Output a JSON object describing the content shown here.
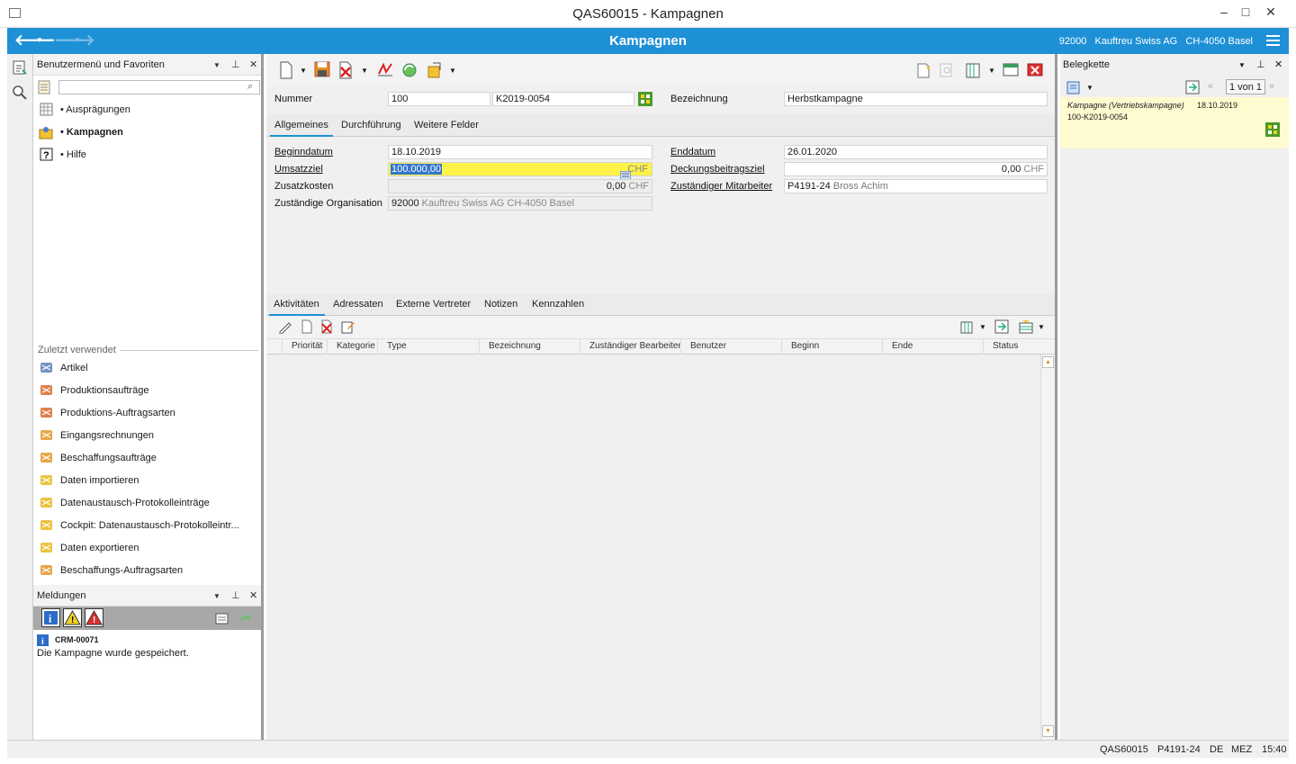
{
  "window": {
    "title": "QAS60015 - Kampagnen",
    "minimize": "–",
    "maximize": "□",
    "close": "✕"
  },
  "navbar": {
    "title": "Kampagnen",
    "org_code": "92000",
    "org_name": "Kauftreu Swiss AG",
    "org_location": "CH-4050 Basel"
  },
  "favorites": {
    "title": "Benutzermenü und Favoriten",
    "search_placeholder": "",
    "items": [
      {
        "label": "• Ausprägungen",
        "icon": "grid-icon"
      },
      {
        "label": "• Kampagnen",
        "icon": "campaign-icon"
      },
      {
        "label": "• Hilfe",
        "icon": "help-icon"
      }
    ],
    "recent_title": "Zuletzt verwendet",
    "recent": [
      {
        "label": "Artikel",
        "icon": "article-icon",
        "color": "#5a7fb8"
      },
      {
        "label": "Produktionsaufträge",
        "icon": "production-icon",
        "color": "#d86a2b"
      },
      {
        "label": "Produktions-Auftragsarten",
        "icon": "production-icon",
        "color": "#d86a2b"
      },
      {
        "label": "Eingangsrechnungen",
        "icon": "purchase-icon",
        "color": "#e2962a"
      },
      {
        "label": "Beschaffungsaufträge",
        "icon": "purchase-icon",
        "color": "#e2962a"
      },
      {
        "label": "Daten importieren",
        "icon": "data-icon",
        "color": "#e8b820"
      },
      {
        "label": "Datenaustausch-Protokolleinträge",
        "icon": "data-icon",
        "color": "#e8b820"
      },
      {
        "label": "Cockpit: Datenaustausch-Protokolleintr...",
        "icon": "data-icon",
        "color": "#e8b820"
      },
      {
        "label": "Daten exportieren",
        "icon": "data-icon",
        "color": "#e8b820"
      },
      {
        "label": "Beschaffungs-Auftragsarten",
        "icon": "purchase-icon",
        "color": "#e2962a"
      }
    ]
  },
  "messages": {
    "title": "Meldungen",
    "code": "CRM-00071",
    "text": "Die Kampagne wurde gespeichert."
  },
  "form": {
    "nummer_label": "Nummer",
    "nummer": "100",
    "nummer_doc": "K2019-0054",
    "bezeichnung_label": "Bezeichnung",
    "bezeichnung": "Herbstkampagne",
    "tabs": [
      "Allgemeines",
      "Durchführung",
      "Weitere Felder"
    ],
    "beginndatum_label": "Beginndatum",
    "beginndatum": "18.10.2019",
    "enddatum_label": "Enddatum",
    "enddatum": "26.01.2020",
    "umsatzziel_label": "Umsatzziel",
    "umsatzziel": "100.000,00",
    "currency": "CHF",
    "deckungsbeitragsziel_label": "Deckungsbeitragsziel",
    "deckungsbeitragsziel": "0,00",
    "zusatzkosten_label": "Zusatzkosten",
    "zusatzkosten": "0,00",
    "mitarbeiter_label": "Zuständiger Mitarbeiter",
    "mitarbeiter_code": "P4191-24",
    "mitarbeiter_name": "Bross Achim",
    "organisation_label": "Zuständige Organisation",
    "organisation_code": "92000",
    "organisation_name": "Kauftreu Swiss AG  CH-4050 Basel"
  },
  "lower": {
    "tabs": [
      "Aktivitäten",
      "Adressaten",
      "Externe Vertreter",
      "Notizen",
      "Kennzahlen"
    ],
    "columns": [
      "Priorität",
      "Kategorie",
      "Type",
      "Bezeichnung",
      "Zuständiger Bearbeiter",
      "Benutzer",
      "Beginn",
      "Ende",
      "Status"
    ]
  },
  "belegkette": {
    "title": "Belegkette",
    "pager": "1 von 1",
    "entry_type": "Kampagne (Vertriebskampagne)",
    "entry_date": "18.10.2019",
    "entry_id": "100-K2019-0054"
  },
  "statusbar": {
    "system": "QAS60015",
    "user": "P4191-24",
    "lang": "DE",
    "tz": "MEZ",
    "time": "15:40"
  }
}
